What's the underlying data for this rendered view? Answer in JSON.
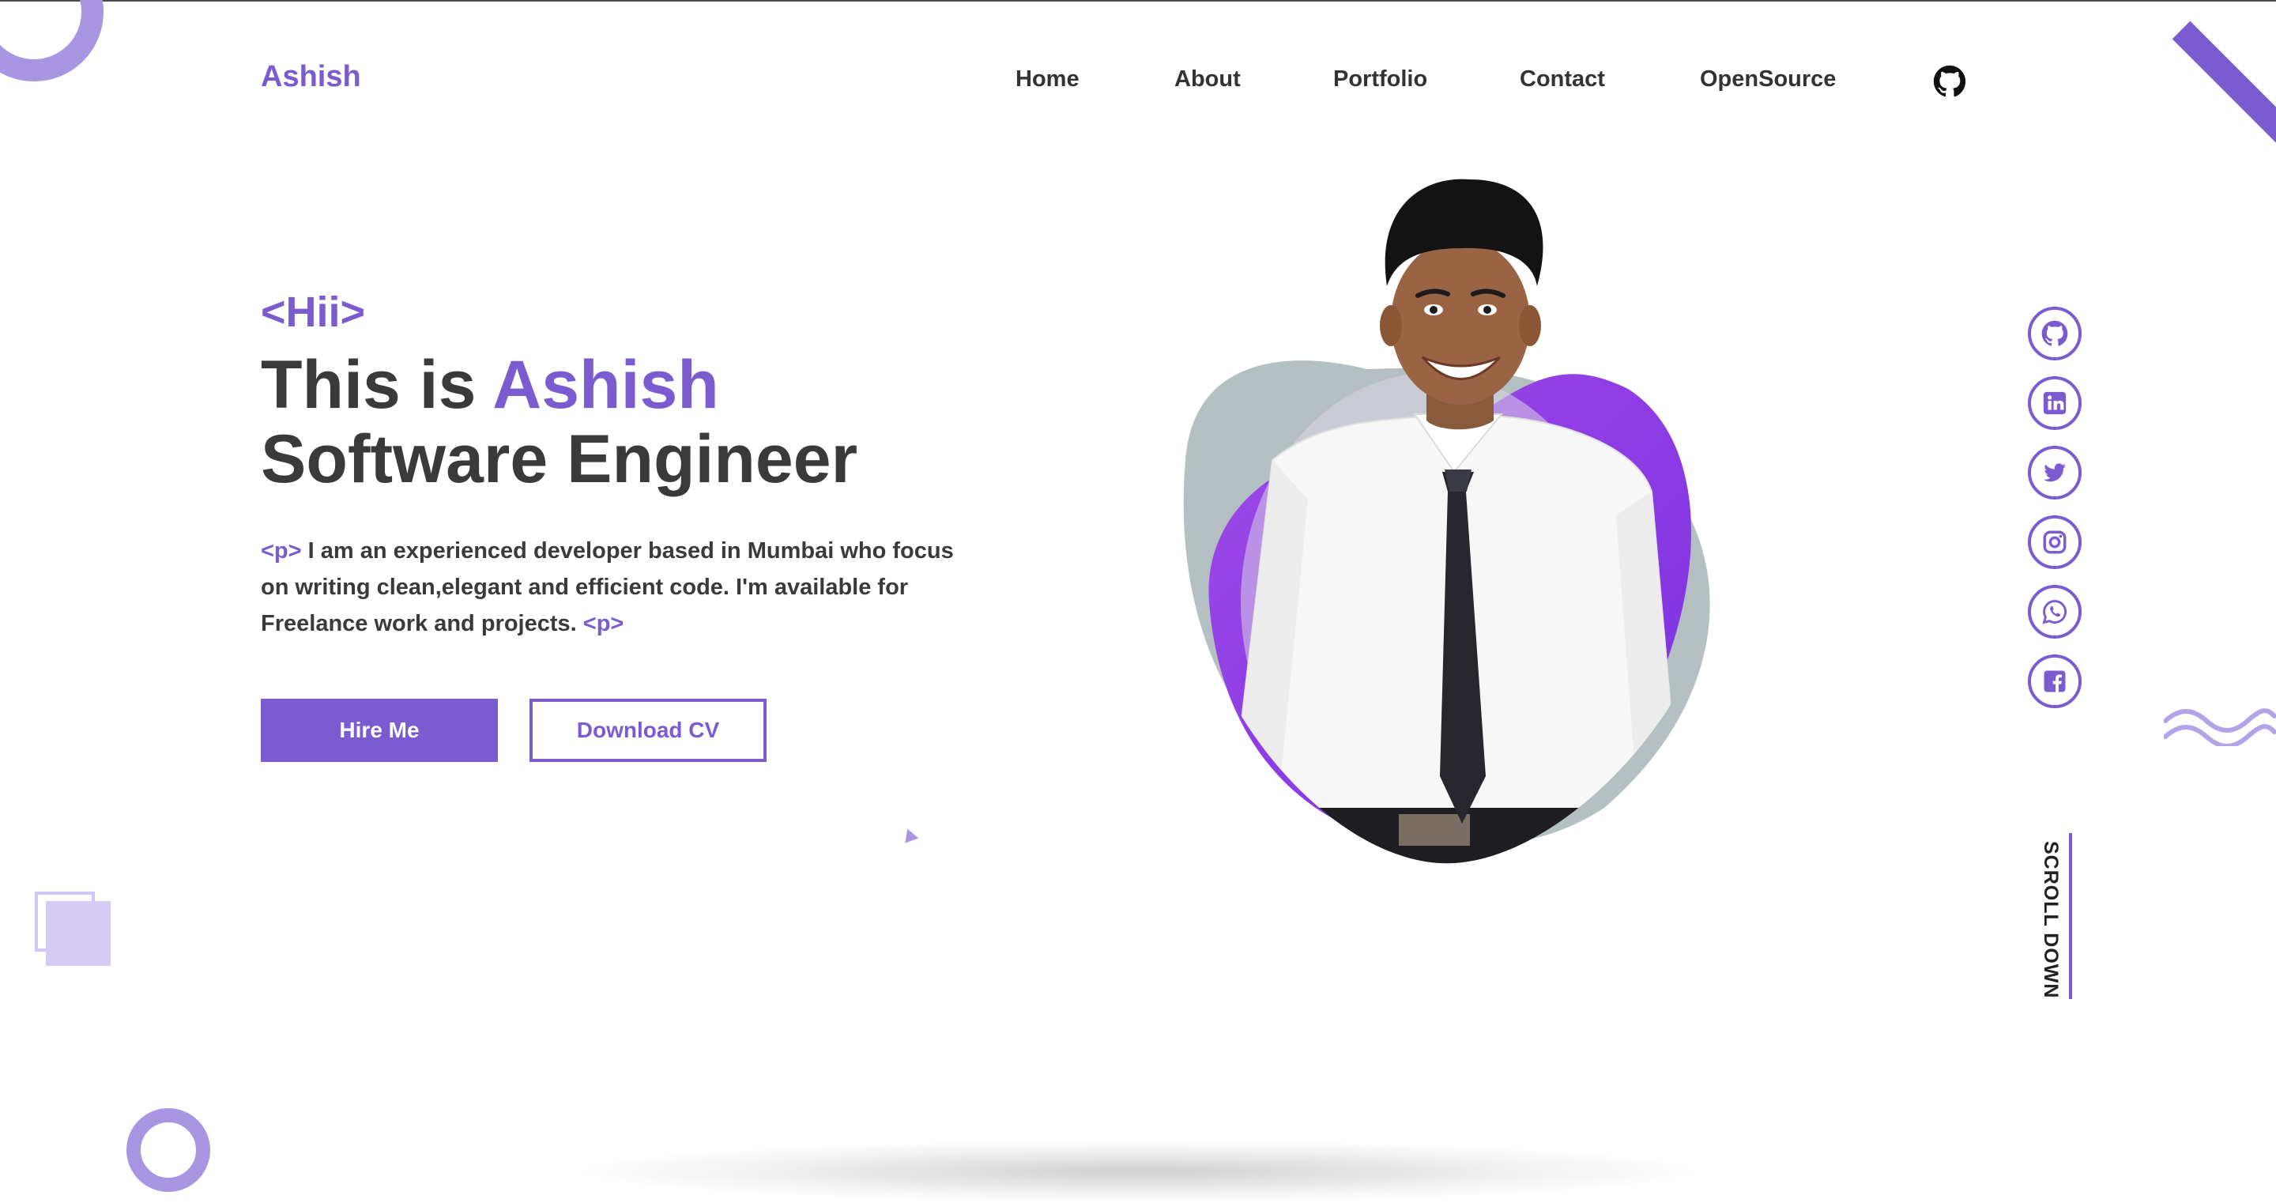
{
  "brand": {
    "logo": "Ashish",
    "accent_color": "#7a5bd0",
    "text_color": "#333333"
  },
  "nav": {
    "items": [
      "Home",
      "About",
      "Portfolio",
      "Contact",
      "OpenSource"
    ],
    "github_icon": "github-icon"
  },
  "hero": {
    "greeting": "<Hii>",
    "title_prefix": "This is ",
    "title_name": "Ashish",
    "subtitle": "Software Engineer",
    "para_open_tag": "<p>",
    "para_text": " I am an experienced developer based in Mumbai who focus on writing clean,elegant and efficient code. I'm available for Freelance work and projects. ",
    "para_close_tag": "<p>",
    "hire_label": "Hire Me",
    "cv_label": "Download CV"
  },
  "social": {
    "icons": [
      "github-icon",
      "linkedin-icon",
      "twitter-icon",
      "instagram-icon",
      "whatsapp-icon",
      "facebook-icon"
    ]
  },
  "scroll": {
    "label": "SCROLL DOWN"
  }
}
